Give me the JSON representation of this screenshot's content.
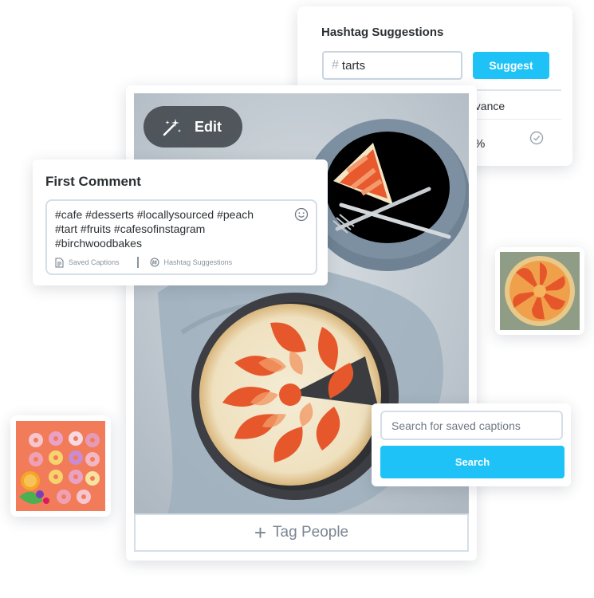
{
  "hashtag_suggestions": {
    "title": "Hashtag Suggestions",
    "input_value": "tarts",
    "suggest_label": "Suggest",
    "relevance_header": "evance",
    "relevance_value": "%"
  },
  "post": {
    "edit_label": "Edit",
    "tag_people_label": "Tag People"
  },
  "first_comment": {
    "title": "First Comment",
    "text_line1": "#cafe #desserts #locallysourced #peach",
    "text_line2": "#tart #fruits #cafesofinstagram",
    "text_line3": "#birchwoodbakes",
    "saved_captions_label": "Saved Captions",
    "hashtag_suggestions_label": "Hashtag Suggestions"
  },
  "caption_search": {
    "placeholder": "Search for saved captions",
    "button_label": "Search"
  },
  "colors": {
    "accent": "#1ec2f7",
    "border": "#d5dee7",
    "text": "#2b2f33"
  },
  "icons": [
    "hash-icon",
    "check-circle-icon",
    "magic-wand-icon",
    "emoji-icon",
    "saved-captions-icon",
    "hashtag-icon",
    "plus-icon"
  ]
}
